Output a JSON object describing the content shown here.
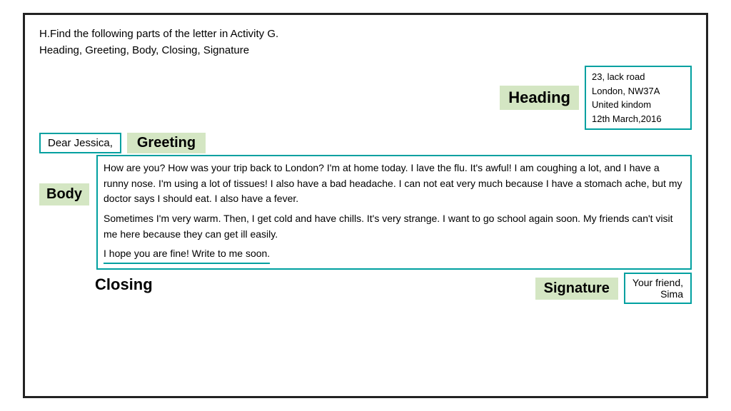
{
  "instructions": {
    "line1": "H.Find the following parts of the letter in Activity G.",
    "line2": "Heading,   Greeting,   Body,   Closing,   Signature"
  },
  "labels": {
    "heading": "Heading",
    "greeting": "Greeting",
    "body": "Body",
    "closing": "Closing",
    "signature": "Signature"
  },
  "address": {
    "line1": "23, lack road",
    "line2": "London, NW37A",
    "line3": "United kindom",
    "line4": "12th March,2016"
  },
  "greeting_text": "Dear Jessica,",
  "body_paragraphs": {
    "p1": "How are you? How was your trip back to London? I'm at home today. I lave the flu. It's awful! I am coughing a lot, and I have a runny nose. I'm using a lot of tissues! I also have a bad headache. I can not eat very much because I have a stomach ache, but my doctor says I should eat. I also have a fever.",
    "p2": "Sometimes I'm very warm. Then, I get cold and have chills. It's very strange. I want to go school again soon. My friends can't visit me here because they can get ill easily.",
    "p3": "I hope you are fine! Write to me soon."
  },
  "signature": {
    "line1": "Your friend,",
    "line2": "Sima"
  }
}
